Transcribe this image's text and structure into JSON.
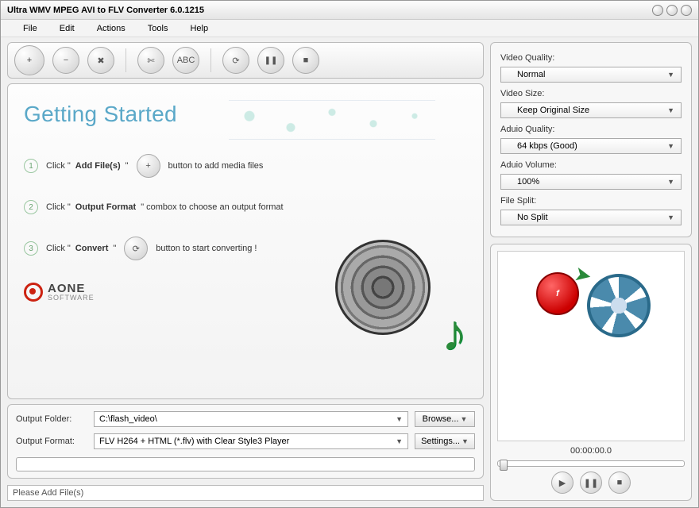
{
  "window": {
    "title": "Ultra WMV MPEG AVI to FLV Converter 6.0.1215"
  },
  "menu": {
    "file": "File",
    "edit": "Edit",
    "actions": "Actions",
    "tools": "Tools",
    "help": "Help"
  },
  "toolbar": {
    "add": "+",
    "remove": "−",
    "clear": "✖",
    "cut": "✄",
    "abc": "ABC",
    "convert": "⟳",
    "pause": "❚❚",
    "stop": "■"
  },
  "getting_started": {
    "title": "Getting Started",
    "step1_a": "Click \"",
    "step1_b": "Add File(s)",
    "step1_c": "\"",
    "step1_d": "button to add media files",
    "step2_a": "Click \"",
    "step2_b": "Output Format",
    "step2_c": "\" combox to choose an output format",
    "step3_a": "Click \"",
    "step3_b": "Convert",
    "step3_c": "\"",
    "step3_d": "button to start converting !"
  },
  "brand": {
    "line1": "AONE",
    "line2": "SOFTWARE"
  },
  "output": {
    "folder_label": "Output Folder:",
    "folder_value": "C:\\flash_video\\",
    "format_label": "Output Format:",
    "format_value": "FLV H264 + HTML (*.flv) with Clear Style3 Player",
    "browse": "Browse...",
    "settings": "Settings..."
  },
  "status": {
    "text": "Please Add File(s)"
  },
  "settings": {
    "video_quality_label": "Video Quality:",
    "video_quality_value": "Normal",
    "video_size_label": "Video Size:",
    "video_size_value": "Keep Original Size",
    "audio_quality_label": "Aduio Quality:",
    "audio_quality_value": "64  kbps (Good)",
    "audio_volume_label": "Aduio Volume:",
    "audio_volume_value": "100%",
    "file_split_label": "File Split:",
    "file_split_value": "No Split"
  },
  "preview": {
    "time": "00:00:00.0",
    "flash_glyph": "f"
  }
}
